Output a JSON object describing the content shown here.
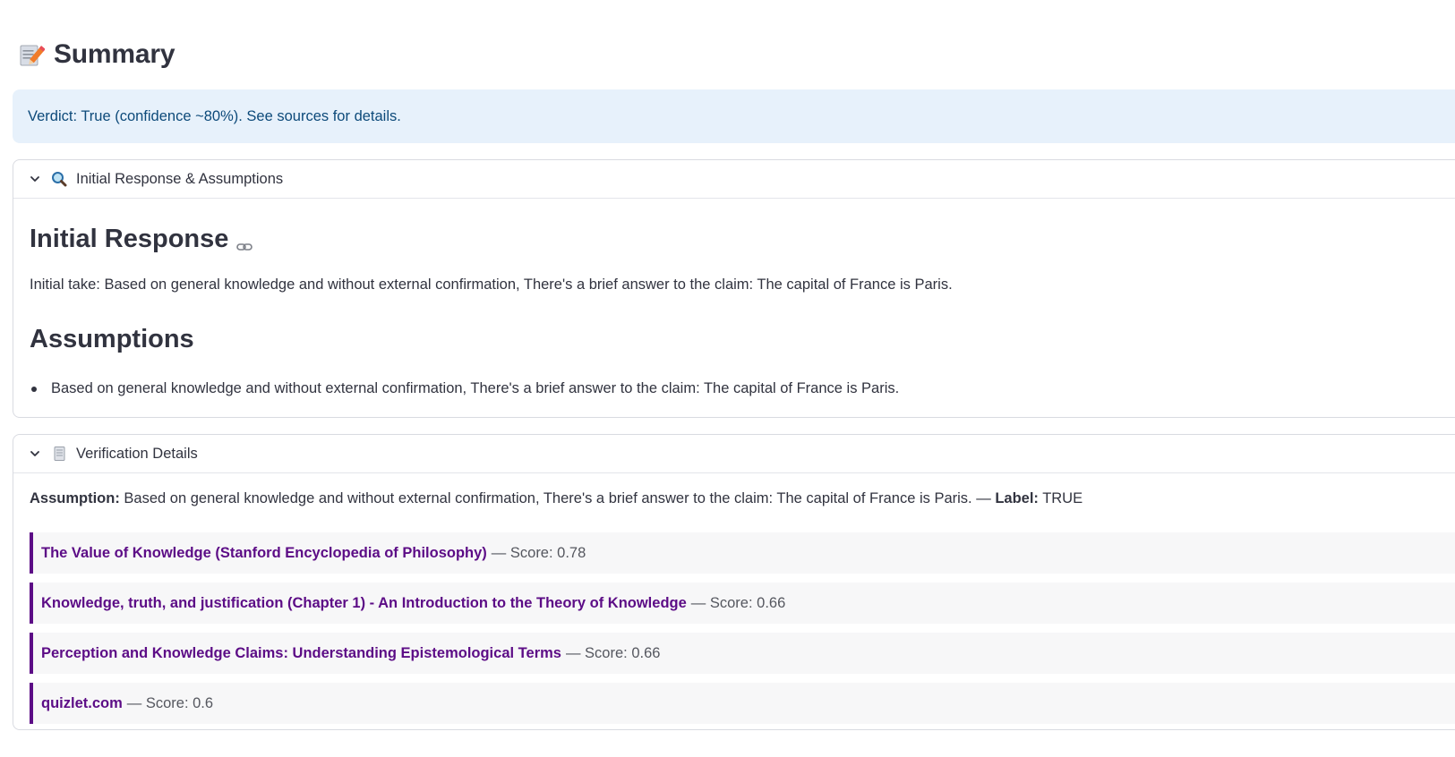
{
  "summary": {
    "icon": "memo-pencil-icon",
    "title": "Summary"
  },
  "verdict": {
    "text": "Verdict: True (confidence ~80%). See sources for details."
  },
  "initial_expander": {
    "icon": "magnifier-icon",
    "header": "Initial Response & Assumptions",
    "initial_response_heading": "Initial Response",
    "initial_take": "Initial take: Based on general knowledge and without external confirmation, There's a brief answer to the claim: The capital of France is Paris.",
    "assumptions_heading": "Assumptions",
    "assumptions": [
      "Based on general knowledge and without external confirmation, There's a brief answer to the claim: The capital of France is Paris."
    ]
  },
  "verification_expander": {
    "icon": "document-icon",
    "header": "Verification Details",
    "assumption_label": "Assumption:",
    "assumption_text": " Based on general knowledge and without external confirmation, There's a brief answer to the claim: The capital of France is Paris. — ",
    "label_label": "Label:",
    "label_value": " TRUE",
    "sources": [
      {
        "title": "The Value of Knowledge (Stanford Encyclopedia of Philosophy)",
        "score": "— Score: 0.78"
      },
      {
        "title": "Knowledge, truth, and justification (Chapter 1) - An Introduction to the Theory of Knowledge",
        "score": "— Score: 0.66"
      },
      {
        "title": "Perception and Knowledge Claims: Understanding Epistemological Terms",
        "score": "— Score: 0.66"
      },
      {
        "title": "quizlet.com",
        "score": "— Score: 0.6"
      }
    ]
  },
  "colors": {
    "link": "#5c0c86",
    "info_bg": "#e7f1fb",
    "info_text": "#0d4a7a"
  }
}
